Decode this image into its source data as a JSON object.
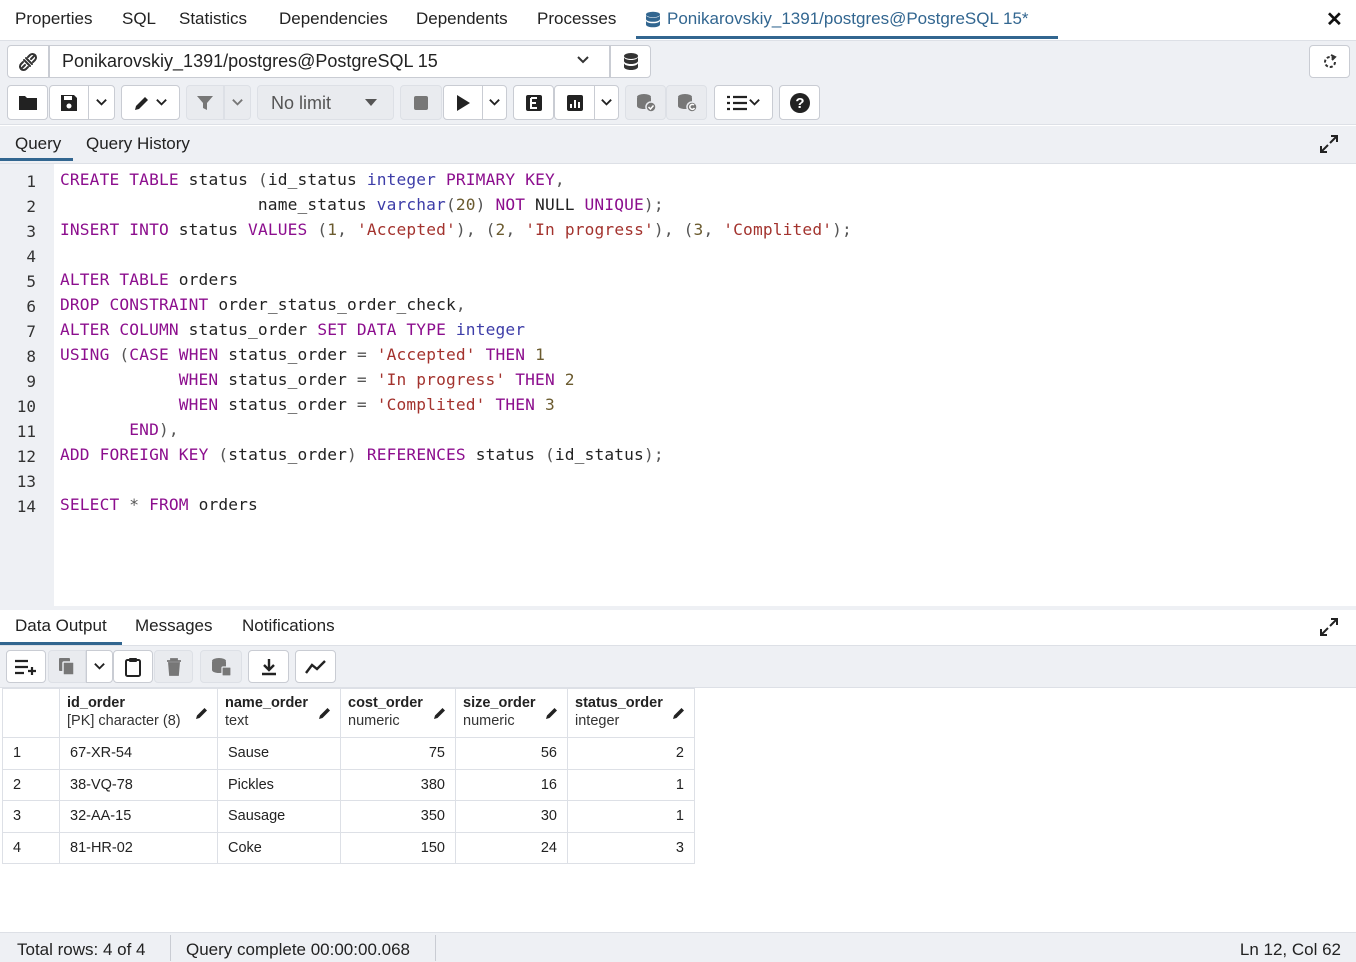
{
  "top_tabs": [
    "Properties",
    "SQL",
    "Statistics",
    "Dependencies",
    "Dependents",
    "Processes"
  ],
  "active_tab": {
    "label": "Ponikarovskiy_1391/postgres@PostgreSQL 15*",
    "icon": "database-icon"
  },
  "connection": {
    "label": "Ponikarovskiy_1391/postgres@PostgreSQL 15"
  },
  "toolbar": {
    "row_limit": "No limit"
  },
  "query_tabs": [
    "Query",
    "Query History"
  ],
  "editor": {
    "line_numbers": [
      "1",
      "2",
      "3",
      "4",
      "5",
      "6",
      "7",
      "8",
      "9",
      "10",
      "11",
      "12",
      "13",
      "14"
    ],
    "lines": [
      "CREATE TABLE status (id_status integer PRIMARY KEY,",
      "                    name_status varchar(20) NOT NULL UNIQUE);",
      "INSERT INTO status VALUES (1, 'Accepted'), (2, 'In progress'), (3, 'Complited');",
      "",
      "ALTER TABLE orders",
      "DROP CONSTRAINT order_status_order_check,",
      "ALTER COLUMN status_order SET DATA TYPE integer",
      "USING (CASE WHEN status_order = 'Accepted' THEN 1",
      "            WHEN status_order = 'In progress' THEN 2",
      "            WHEN status_order = 'Complited' THEN 3",
      "       END),",
      "ADD FOREIGN KEY (status_order) REFERENCES status (id_status);",
      "",
      "SELECT * FROM orders"
    ]
  },
  "output_tabs": [
    "Data Output",
    "Messages",
    "Notifications"
  ],
  "grid": {
    "columns": [
      {
        "name": "id_order",
        "type": "[PK] character (8)"
      },
      {
        "name": "name_order",
        "type": "text"
      },
      {
        "name": "cost_order",
        "type": "numeric"
      },
      {
        "name": "size_order",
        "type": "numeric"
      },
      {
        "name": "status_order",
        "type": "integer"
      }
    ],
    "rows": [
      {
        "n": "1",
        "id_order": "67-XR-54",
        "name_order": "Sause",
        "cost_order": "75",
        "size_order": "56",
        "status_order": "2"
      },
      {
        "n": "2",
        "id_order": "38-VQ-78",
        "name_order": "Pickles",
        "cost_order": "380",
        "size_order": "16",
        "status_order": "1"
      },
      {
        "n": "3",
        "id_order": "32-AA-15",
        "name_order": "Sausage",
        "cost_order": "350",
        "size_order": "30",
        "status_order": "1"
      },
      {
        "n": "4",
        "id_order": "81-HR-02",
        "name_order": "Coke",
        "cost_order": "150",
        "size_order": "24",
        "status_order": "3"
      }
    ]
  },
  "status_bar": {
    "total_rows": "Total rows: 4 of 4",
    "query_time": "Query complete 00:00:00.068",
    "cursor": "Ln 12, Col 62"
  },
  "colors": {
    "accent": "#326690",
    "keyword": "#8c0e8e",
    "string": "#a3332e",
    "type": "#3d3da8"
  }
}
